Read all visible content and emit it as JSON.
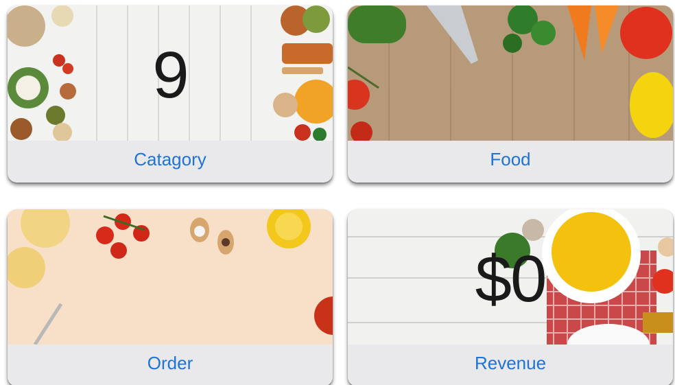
{
  "cards": [
    {
      "label": "Catagory",
      "value": "9"
    },
    {
      "label": "Food",
      "value": ""
    },
    {
      "label": "Order",
      "value": ""
    },
    {
      "label": "Revenue",
      "value": "$0"
    }
  ],
  "colors": {
    "label_text": "#1f73d6",
    "value_text": "#1a1a1a",
    "footer_bg": "#e9e8ea"
  }
}
